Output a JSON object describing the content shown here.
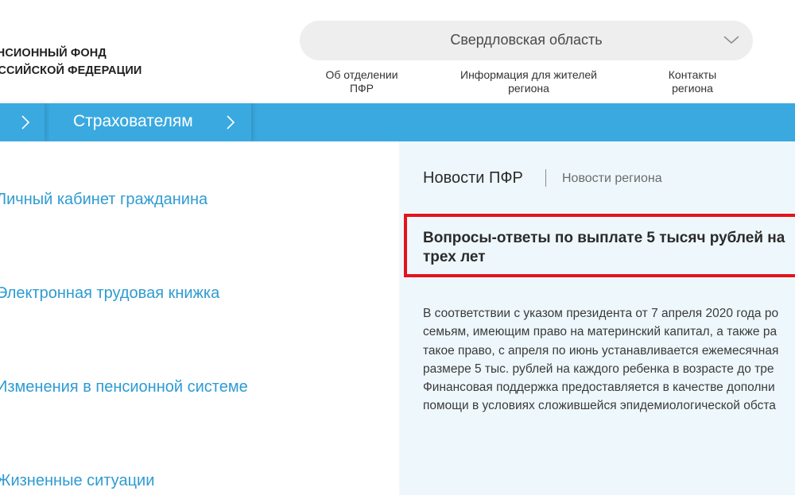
{
  "logo": {
    "line1": "ЕНСИОННЫЙ ФОНД",
    "line2": "ОССИЙСКОЙ ФЕДЕРАЦИИ"
  },
  "region_select": {
    "value": "Свердловская область",
    "icon": "chevron-down-icon"
  },
  "top_nav": {
    "about": {
      "line1": "Об отделении",
      "line2": "ПФР"
    },
    "info": {
      "line1": "Информация для жителей",
      "line2": "региона"
    },
    "contacts": {
      "line1": "Контакты",
      "line2": "региона"
    }
  },
  "breadcrumb": {
    "current": "Страхователям",
    "separator_icon": "chevron-right-icon"
  },
  "left_menu": {
    "items": [
      "Личный кабинет гражданина",
      "Электронная трудовая книжка",
      "Изменения в пенсионной системе",
      "Жизненные ситуации"
    ]
  },
  "news": {
    "tabs": [
      "Новости ПФР",
      "Новости региона"
    ],
    "headline": {
      "line1": "Вопросы-ответы по выплате 5 тысяч рублей на",
      "line2": "трех лет"
    },
    "body_lines": [
      "В соответствии с указом президента от 7 апреля 2020 года ро",
      "семьям, имеющим право на материнский капитал, а также ра",
      "такое право, с апреля по июнь устанавливается ежемесячная",
      "размере 5 тыс. рублей на каждого ребенка в возрасте до тре",
      "Финансовая поддержка предоставляется в качестве дополни",
      "помощи в условиях сложившейся эпидемиологической обста"
    ]
  },
  "colors": {
    "brand_blue": "#3aa9e0",
    "link_blue": "#2e9bd3",
    "highlight_red": "#e5131d",
    "panel_bg": "#eef8fc"
  }
}
